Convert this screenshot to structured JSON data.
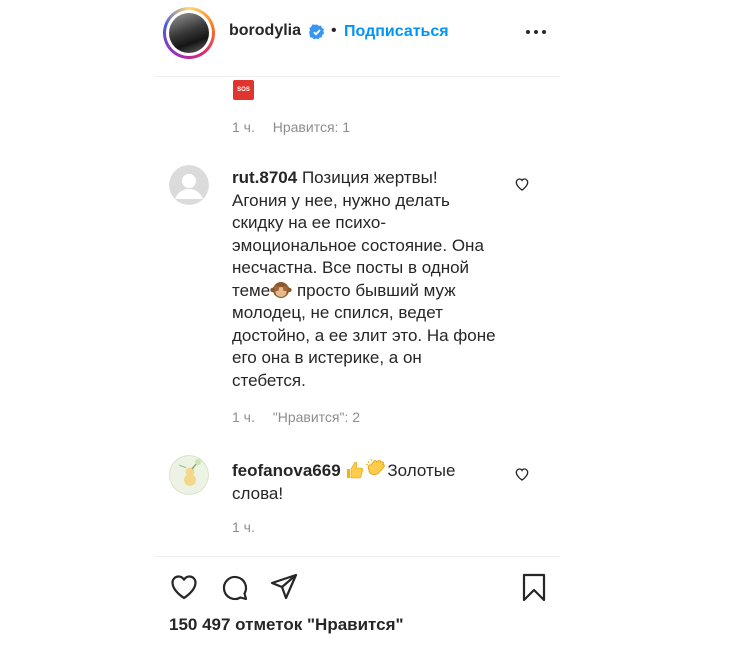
{
  "header": {
    "username": "borodylia",
    "separator": "•",
    "follow_label": "Подписаться"
  },
  "first_comment": {
    "time": "1 ч.",
    "likes": "Нравится: 1"
  },
  "comments": [
    {
      "username": "rut.8704",
      "lines": [
        "Позиция жертвы!",
        "Агония у нее, нужно делать",
        "скидку на ее психо-",
        "эмоциональное состояние. Она",
        "несчастна. Все посты в одной",
        "теме",
        "просто бывший муж",
        "молодец, не спился, ведет",
        "достойно, а ее злит это. На фоне",
        "его она в истерике, а он",
        "стебется."
      ],
      "time": "1 ч.",
      "likes": "\"Нравится\": 2"
    },
    {
      "username": "feofanova669",
      "lines": [
        "Золотые",
        "слова!"
      ],
      "time": "1 ч."
    }
  ],
  "actions": {
    "like_icon": "heart-icon",
    "comment_icon": "comment-icon",
    "share_icon": "share-icon",
    "save_icon": "bookmark-icon"
  },
  "likes_count": "150 497 отметок \"Нравится\"",
  "colors": {
    "accent": "#0095f6",
    "text": "#262626",
    "muted": "#8e8e8e",
    "sos_badge": "#e0352f"
  }
}
